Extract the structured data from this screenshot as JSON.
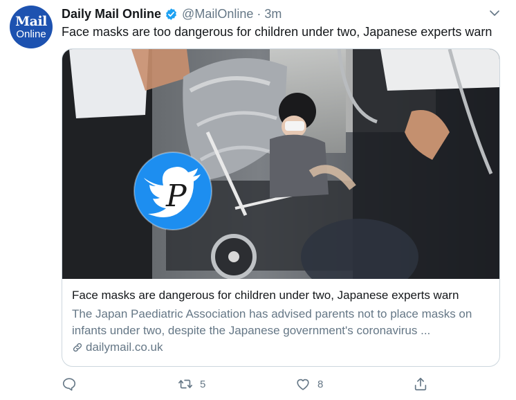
{
  "account": {
    "avatar_line1": "Mail",
    "avatar_line2": "Online",
    "display_name": "Daily Mail Online",
    "handle": "@MailOnline",
    "separator": "·",
    "timestamp": "3m"
  },
  "tweet": {
    "text": "Face masks are too dangerous for children under two, Japanese experts warn"
  },
  "card": {
    "watermark_letter": "P",
    "title": "Face masks are dangerous for children under two, Japanese experts warn",
    "description": "The Japan Paediatric Association has advised parents not to place masks on infants under two, despite the Japanese government's coronavirus ...",
    "domain": "dailymail.co.uk"
  },
  "actions": {
    "reply_icon": "reply-icon",
    "retweet_icon": "retweet-icon",
    "retweet_count": "5",
    "like_icon": "heart-icon",
    "like_count": "8",
    "share_icon": "share-icon"
  },
  "colors": {
    "brand_blue": "#1d52b0",
    "twitter_blue": "#1da1f2",
    "text_primary": "#14171a",
    "text_secondary": "#657786",
    "border": "#ccd6dd"
  }
}
